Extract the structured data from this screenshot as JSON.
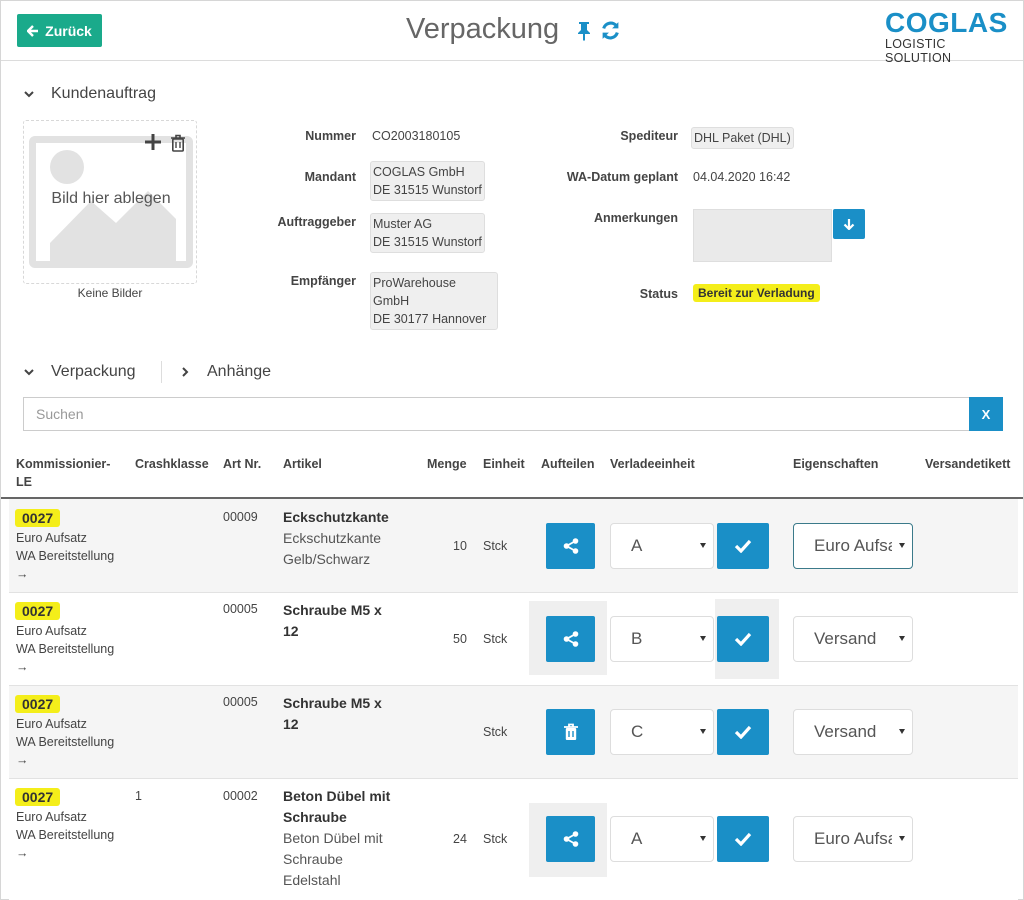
{
  "header": {
    "back_label": "Zurück",
    "title": "Verpackung",
    "logo_main": "COGLAS",
    "logo_sub": "LOGISTIC SOLUTION"
  },
  "kundenauftrag": {
    "section_title": "Kundenauftrag",
    "drop_text": "Bild hier ablegen",
    "no_images": "Keine Bilder",
    "nummer_label": "Nummer",
    "nummer": "CO2003180105",
    "mandant_label": "Mandant",
    "mandant_line1": "COGLAS GmbH",
    "mandant_line2": "DE 31515 Wunstorf",
    "auftraggeber_label": "Auftraggeber",
    "auftraggeber_line1": "Muster AG",
    "auftraggeber_line2": "DE 31515 Wunstorf",
    "empfaenger_label": "Empfänger",
    "empfaenger_line1": "ProWarehouse GmbH",
    "empfaenger_line2": "DE 30177 Hannover",
    "spediteur_label": "Spediteur",
    "spediteur": "DHL Paket (DHL)",
    "wa_datum_label": "WA-Datum geplant",
    "wa_datum": "04.04.2020 16:42",
    "anmerkungen_label": "Anmerkungen",
    "status_label": "Status",
    "status": "Bereit zur Verladung",
    "status_color": "#f4ee1a"
  },
  "tabs": {
    "verpackung": "Verpackung",
    "anhaenge": "Anhänge"
  },
  "search": {
    "placeholder": "Suchen",
    "clear_label": "X"
  },
  "table": {
    "headers": {
      "kommissionier_line1": "Kommissionier-",
      "kommissionier_line2": "LE",
      "crashklasse": "Crashklasse",
      "art_nr": "Art Nr.",
      "artikel": "Artikel",
      "menge": "Menge",
      "einheit": "Einheit",
      "aufteilen": "Aufteilen",
      "verladeeinheit": "Verladeeinheit",
      "eigenschaften": "Eigenschaften",
      "versandetikett": "Versandetikett"
    },
    "rows": [
      {
        "le": "0027",
        "le_line1": "Euro Aufsatz",
        "le_line2": "WA Bereitstellung",
        "le_arrow": "→",
        "crashklasse": "",
        "art_nr": "00009",
        "artikel_title": "Eckschutzkante",
        "artikel_desc_1": "Eckschutzkante",
        "artikel_desc_2": "Gelb/Schwarz",
        "artikel_desc_3": "",
        "menge": "10",
        "einheit": "Stck",
        "action": "share",
        "verladeeinheit": "A",
        "eigenschaft": "Euro Aufsatz"
      },
      {
        "le": "0027",
        "le_line1": "Euro Aufsatz",
        "le_line2": "WA Bereitstellung",
        "le_arrow": "→",
        "crashklasse": "",
        "art_nr": "00005",
        "artikel_title_1": "Schraube M5 x",
        "artikel_title_2": "12",
        "menge": "50",
        "einheit": "Stck",
        "action": "share",
        "verladeeinheit": "B",
        "eigenschaft": "Versand"
      },
      {
        "le": "0027",
        "le_line1": "Euro Aufsatz",
        "le_line2": "WA Bereitstellung",
        "le_arrow": "→",
        "crashklasse": "",
        "art_nr": "00005",
        "artikel_title_1": "Schraube M5 x",
        "artikel_title_2": "12",
        "menge": "",
        "einheit": "Stck",
        "action": "delete",
        "verladeeinheit": "C",
        "eigenschaft": "Versand"
      },
      {
        "le": "0027",
        "le_line1": "Euro Aufsatz",
        "le_line2": "WA Bereitstellung",
        "le_arrow": "→",
        "crashklasse": "1",
        "art_nr": "00002",
        "artikel_title_1": "Beton Dübel mit",
        "artikel_title_2": "Schraube",
        "artikel_desc_1": "Beton Dübel mit",
        "artikel_desc_2": "Schraube",
        "artikel_desc_3": "Edelstahl",
        "menge": "24",
        "einheit": "Stck",
        "action": "share",
        "verladeeinheit": "A",
        "eigenschaft": "Euro Aufsatz"
      }
    ]
  },
  "colors": {
    "primary_blue": "#1a8fc7",
    "back_green": "#1aaa8b",
    "highlight_yellow": "#f4ee1a"
  },
  "icons": [
    "arrow-left-icon",
    "pin-icon",
    "refresh-icon",
    "chevron-down-icon",
    "chevron-right-icon",
    "plus-icon",
    "trash-icon",
    "image-placeholder-icon",
    "arrow-down-icon",
    "share-icon",
    "check-icon"
  ]
}
